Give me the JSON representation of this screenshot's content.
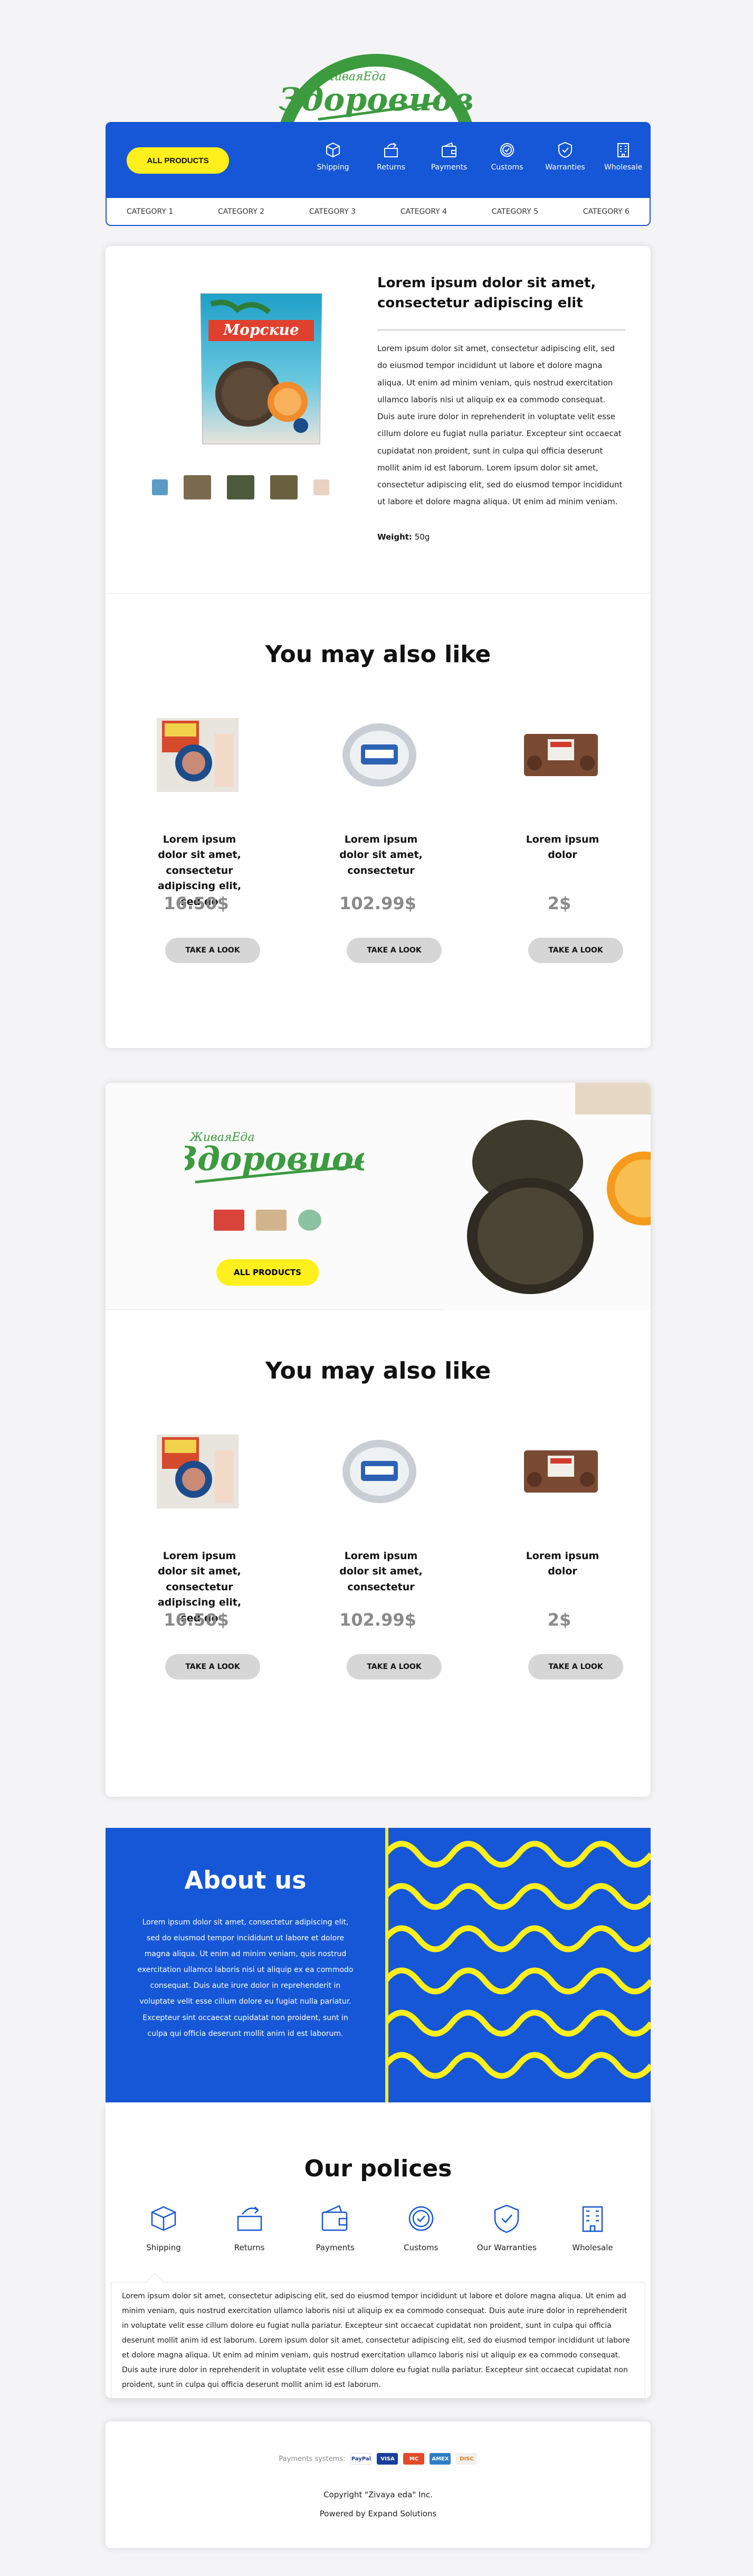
{
  "header": {
    "logo_small": "ЖиваяЕда",
    "logo_main": "Здоровиов",
    "all_products": "ALL PRODUCTS",
    "nav": [
      {
        "label": "Shipping",
        "icon": "box-icon"
      },
      {
        "label": "Returns",
        "icon": "return-icon"
      },
      {
        "label": "Payments",
        "icon": "wallet-icon"
      },
      {
        "label": "Customs",
        "icon": "badge-check-icon"
      },
      {
        "label": "Warranties",
        "icon": "shield-icon"
      },
      {
        "label": "Wholesale",
        "icon": "building-icon"
      }
    ],
    "categories": [
      "CATEGORY 1",
      "CATEGORY 2",
      "CATEGORY 3",
      "CATEGORY 4",
      "CATEGORY 5",
      "CATEGORY 6"
    ]
  },
  "product": {
    "title": "Lorem ipsum dolor sit amet, consectetur adipiscing elit",
    "description": "Lorem ipsum dolor sit amet, consectetur adipiscing elit, sed do eiusmod tempor incididunt ut labore et dolore magna aliqua. Ut enim ad minim veniam, quis nostrud exercitation ullamco laboris nisi ut aliquip ex ea commodo consequat. Duis aute irure dolor in reprehenderit in voluptate velit esse cillum dolore eu fugiat nulla pariatur. Excepteur sint occaecat cupidatat non proident, sunt in culpa qui officia deserunt mollit anim id est laborum. Lorem ipsum dolor sit amet, consectetur adipiscing elit, sed do eiusmod tempor incididunt ut labore et dolore magna aliqua. Ut enim ad minim veniam.",
    "weight_label": "Weight:",
    "weight_value": "50g",
    "package_text": "Морские"
  },
  "also_like_1": {
    "title": "You may also like",
    "items": [
      {
        "name": "Lorem ipsum dolor sit amet, consectetur adipiscing elit, sed do",
        "price": "16.50$",
        "button": "TAKE A LOOK"
      },
      {
        "name": "Lorem ipsum dolor sit amet, consectetur",
        "price": "102.99$",
        "button": "TAKE A LOOK"
      },
      {
        "name": "Lorem ipsum dolor",
        "price": "2$",
        "button": "TAKE A LOOK"
      }
    ]
  },
  "banner": {
    "logo_small": "ЖиваяЕда",
    "logo_main": "Здоровиов",
    "button": "ALL PRODUCTS"
  },
  "also_like_2": {
    "title": "You may also like",
    "items": [
      {
        "name": "Lorem ipsum dolor sit amet, consectetur adipiscing elit, sed do",
        "price": "16.50$",
        "button": "TAKE A LOOK"
      },
      {
        "name": "Lorem ipsum dolor sit amet, consectetur",
        "price": "102.99$",
        "button": "TAKE A LOOK"
      },
      {
        "name": "Lorem ipsum dolor",
        "price": "2$",
        "button": "TAKE A LOOK"
      }
    ]
  },
  "about": {
    "title": "About us",
    "text": "Lorem ipsum dolor sit amet, consectetur adipiscing elit, sed do eiusmod tempor incididunt ut labore et dolore magna aliqua. Ut enim ad minim veniam, quis nostrud exercitation ullamco laboris nisi ut aliquip ex ea commodo consequat. Duis aute irure dolor in reprehenderit in voluptate velit esse cillum dolore eu fugiat nulla pariatur. Excepteur sint occaecat cupidatat non proident, sunt in culpa qui officia deserunt mollit anim id est laborum."
  },
  "policies": {
    "title": "Our polices",
    "items": [
      {
        "label": "Shipping",
        "icon": "box-icon"
      },
      {
        "label": "Returns",
        "icon": "return-icon"
      },
      {
        "label": "Payments",
        "icon": "wallet-icon"
      },
      {
        "label": "Customs",
        "icon": "badge-check-icon"
      },
      {
        "label": "Our Warranties",
        "icon": "shield-icon"
      },
      {
        "label": "Wholesale",
        "icon": "building-icon"
      }
    ],
    "text": "Lorem ipsum dolor sit amet, consectetur adipiscing elit, sed do eiusmod tempor incididunt ut labore et dolore magna aliqua. Ut enim ad minim veniam, quis nostrud exercitation ullamco laboris nisi ut aliquip ex ea commodo consequat. Duis aute irure dolor in reprehenderit in voluptate velit esse cillum dolore eu fugiat nulla pariatur. Excepteur sint occaecat cupidatat non proident, sunt in culpa qui officia deserunt mollit anim id est laborum. Lorem ipsum dolor sit amet, consectetur adipiscing elit, sed do eiusmod tempor incididunt ut labore et dolore magna aliqua. Ut enim ad minim veniam, quis nostrud exercitation ullamco laboris nisi ut aliquip ex ea commodo consequat. Duis aute irure dolor in reprehenderit in voluptate velit esse cillum dolore eu fugiat nulla pariatur. Excepteur sint occaecat cupidatat non proident, sunt in culpa qui officia deserunt mollit anim id est laborum."
  },
  "footer": {
    "payments_label": "Payments systems:",
    "payment_logos": [
      "PayPal",
      "VISA",
      "MC",
      "AMEX",
      "DISC"
    ],
    "copyright": "Copyright \"Zivaya eda\" Inc.",
    "powered": "Powered by Expand Solutions"
  },
  "colors": {
    "brand_blue": "#1557d6",
    "accent_yellow": "#ffef1c",
    "logo_green": "#3c9a3f"
  }
}
